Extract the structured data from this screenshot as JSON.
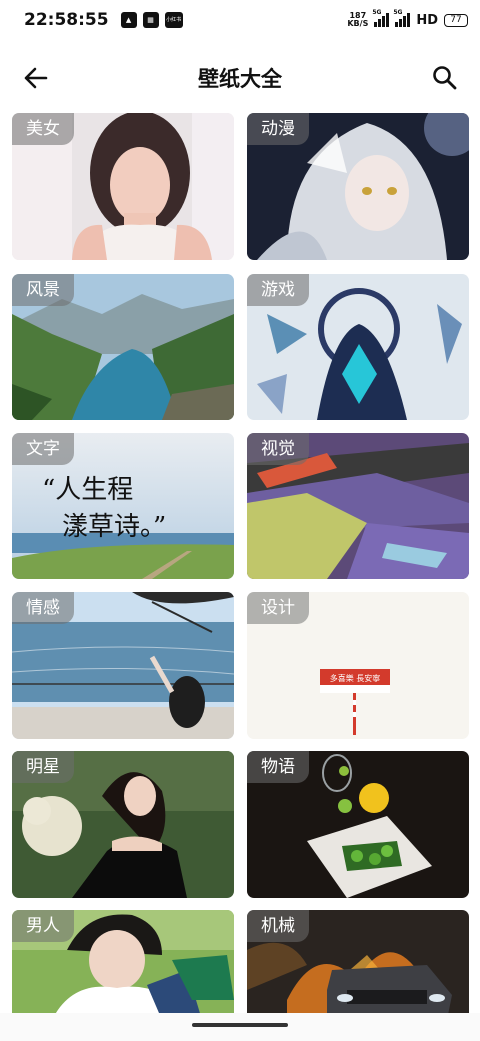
{
  "status_bar": {
    "time": "22:58:55",
    "notif_icons": [
      "app-icon",
      "qr-app-icon",
      "news-app-icon"
    ],
    "notif_text": [
      "",
      "",
      "小红书"
    ],
    "net_speed_value": "187",
    "net_speed_unit": "KB/S",
    "sim1_label": "5G",
    "sim2_label": "5G",
    "hd_label": "HD",
    "battery": "77"
  },
  "header": {
    "title": "壁纸大全",
    "back_icon": "arrow-left-icon",
    "search_icon": "search-icon"
  },
  "categories": [
    {
      "label": "美女"
    },
    {
      "label": "动漫"
    },
    {
      "label": "风景"
    },
    {
      "label": "游戏"
    },
    {
      "label": "文字"
    },
    {
      "label": "视觉"
    },
    {
      "label": "情感"
    },
    {
      "label": "设计"
    },
    {
      "label": "明星"
    },
    {
      "label": "物语"
    },
    {
      "label": "男人"
    },
    {
      "label": "机械"
    }
  ],
  "card_text": {
    "calligraphy_line1": "“人生程",
    "calligraphy_line2": "漾草诗。”",
    "sign_text": "多喜樂 長安寧"
  }
}
